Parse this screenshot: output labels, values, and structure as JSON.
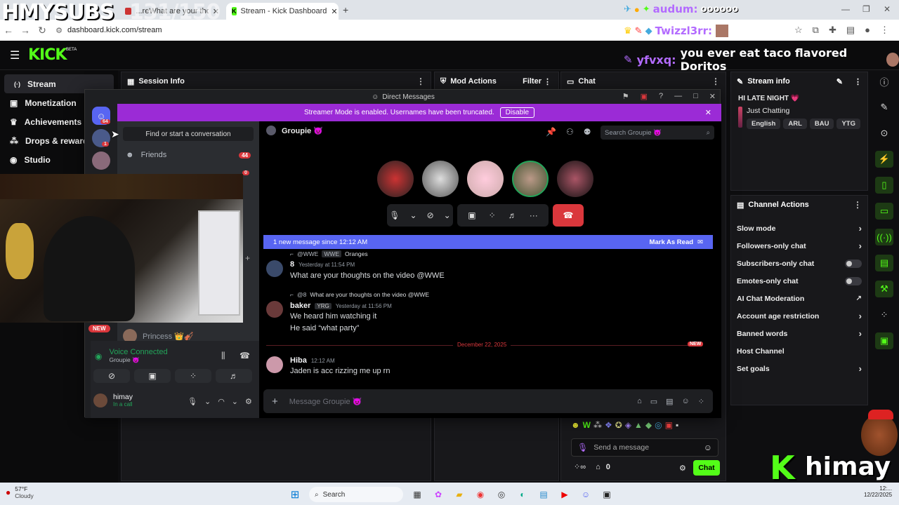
{
  "browser": {
    "tabs": [
      {
        "label": "...reWhat are your thoughts...",
        "active": false
      },
      {
        "label": "Stream - Kick Dashboard",
        "active": true
      }
    ],
    "url": "dashboard.kick.com/stream",
    "new_tab": "+"
  },
  "overlay": {
    "subs_label": "HMYSUBS",
    "subs_count": "131/150",
    "alert_top_user": "audum:",
    "alert_top_msg": "oooooo",
    "alert_mid_user": "Twizzl3rr:",
    "chat_user": "yfvxq:",
    "chat_msg": "you ever eat taco flavored Doritos",
    "brand_letter": "K",
    "brand_name": "himay",
    "new_badge": "NEW"
  },
  "kick": {
    "logo": "KICK",
    "logo_badge": "BETA",
    "sidebar": [
      {
        "label": "Stream",
        "icon": "(·)"
      },
      {
        "label": "Monetization",
        "icon": "▣"
      },
      {
        "label": "Achievements",
        "icon": "♛"
      },
      {
        "label": "Drops & rewards",
        "icon": "⁂"
      },
      {
        "label": "Studio",
        "icon": "◉"
      }
    ],
    "panels": {
      "session_info": "Session Info",
      "mod_actions": "Mod Actions",
      "filter": "Filter",
      "chat": "Chat",
      "stream_info": "Stream info",
      "channel_actions": "Channel Actions"
    },
    "stream_info": {
      "title": "HI LATE NIGHT 💗",
      "category": "Just Chatting",
      "tags": [
        "English",
        "ARL",
        "BAU",
        "YTG"
      ]
    },
    "channel_actions": [
      {
        "label": "Slow mode",
        "control": "arrow"
      },
      {
        "label": "Followers-only chat",
        "control": "arrow"
      },
      {
        "label": "Subscribers-only chat",
        "control": "toggle"
      },
      {
        "label": "Emotes-only chat",
        "control": "toggle"
      },
      {
        "label": "AI Chat Moderation",
        "control": "external"
      },
      {
        "label": "Account age restriction",
        "control": "arrow"
      },
      {
        "label": "Banned words",
        "control": "arrow"
      },
      {
        "label": "Host Channel",
        "control": "none"
      },
      {
        "label": "Set goals",
        "control": "arrow"
      }
    ],
    "chat_input_placeholder": "Send a message",
    "chat_button": "Chat",
    "viewer_count": "0"
  },
  "discord": {
    "window_title": "Direct Messages",
    "streamer_banner": "Streamer Mode is enabled. Usernames have been truncated.",
    "disable_btn": "Disable",
    "find_placeholder": "Find or start a conversation",
    "friends_label": "Friends",
    "friends_badge": "44",
    "server_badge": "64",
    "server_badge2": "1",
    "dm_badge": "0",
    "dm_princess": "Princess 👑🎻",
    "voice_connected": "Voice Connected",
    "voice_channel": "Groupie 😈",
    "user_name": "himay",
    "user_status": "In a call",
    "channel_name": "Groupie 😈",
    "search_placeholder": "Search Groupie 😈",
    "new_message_bar": "1 new message since 12:12 AM",
    "mark_read": "Mark As Read",
    "messages": [
      {
        "reply_user": "@WWE",
        "reply_tag": "WWE",
        "reply_text": "Oranges",
        "user": "8",
        "tag": "",
        "time": "Yesterday at 11:54 PM",
        "lines": [
          "What are your thoughts on the video @WWE"
        ]
      },
      {
        "reply_user": "@8",
        "reply_tag": "",
        "reply_text": "What are your thoughts on the video @WWE",
        "user": "baker",
        "tag": "YRG",
        "time": "Yesterday at 11:56 PM",
        "lines": [
          "We heard him watching it",
          "He said “what party”"
        ]
      }
    ],
    "date_divider": "December 22, 2025",
    "divider_new": "NEW",
    "last_msg": {
      "user": "Hiba",
      "time": "12:12 AM",
      "text": "Jaden is acc rizzing me up rn"
    },
    "input_placeholder": "Message Groupie 😈"
  },
  "taskbar": {
    "weather_temp": "57°F",
    "weather_desc": "Cloudy",
    "search": "Search",
    "clock_time": "12:...",
    "clock_date": "12/22/2025"
  },
  "colors": {
    "kick_green": "#53fc18",
    "discord_purple": "#5865f2",
    "banner_purple": "#9b2bd6",
    "end_call_red": "#da373c"
  }
}
